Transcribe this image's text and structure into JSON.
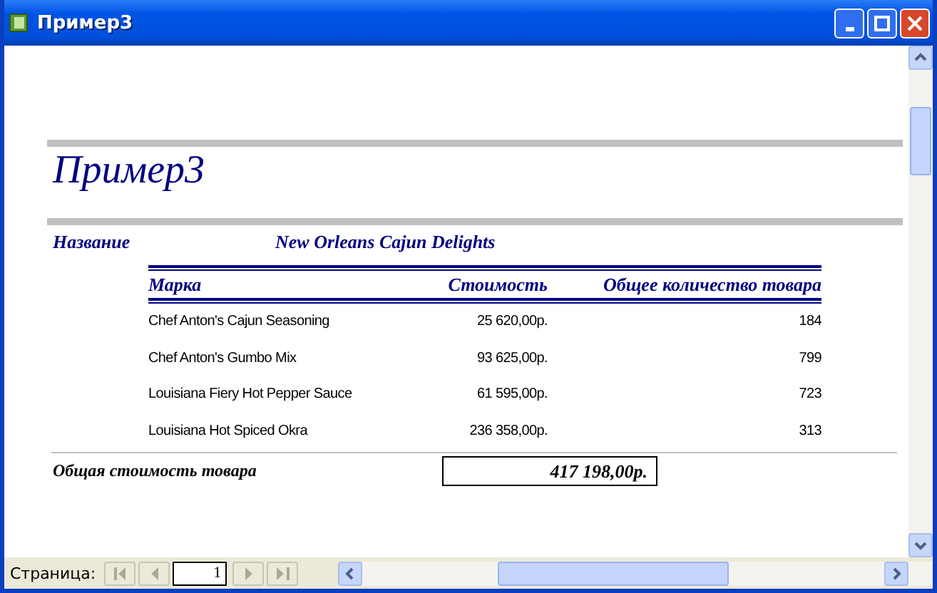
{
  "window": {
    "title": "Пример3"
  },
  "report": {
    "title": "Пример3",
    "name_label": "Название",
    "name_value": "New Orleans Cajun Delights",
    "columns": [
      "Марка",
      "Стоимость",
      "Общее количество товара"
    ],
    "rows": [
      {
        "brand": "Chef Anton's Cajun Seasoning",
        "cost": "25 620,00р.",
        "quantity": "184"
      },
      {
        "brand": "Chef Anton's Gumbo Mix",
        "cost": "93 625,00р.",
        "quantity": "799"
      },
      {
        "brand": "Louisiana Fiery Hot Pepper Sauce",
        "cost": "61 595,00р.",
        "quantity": "723"
      },
      {
        "brand": "Louisiana Hot Spiced Okra",
        "cost": "236 358,00р.",
        "quantity": "313"
      }
    ],
    "total_label": "Общая стоимость товара",
    "total_value": "417 198,00р."
  },
  "navigation": {
    "label": "Страница:",
    "page": "1"
  }
}
